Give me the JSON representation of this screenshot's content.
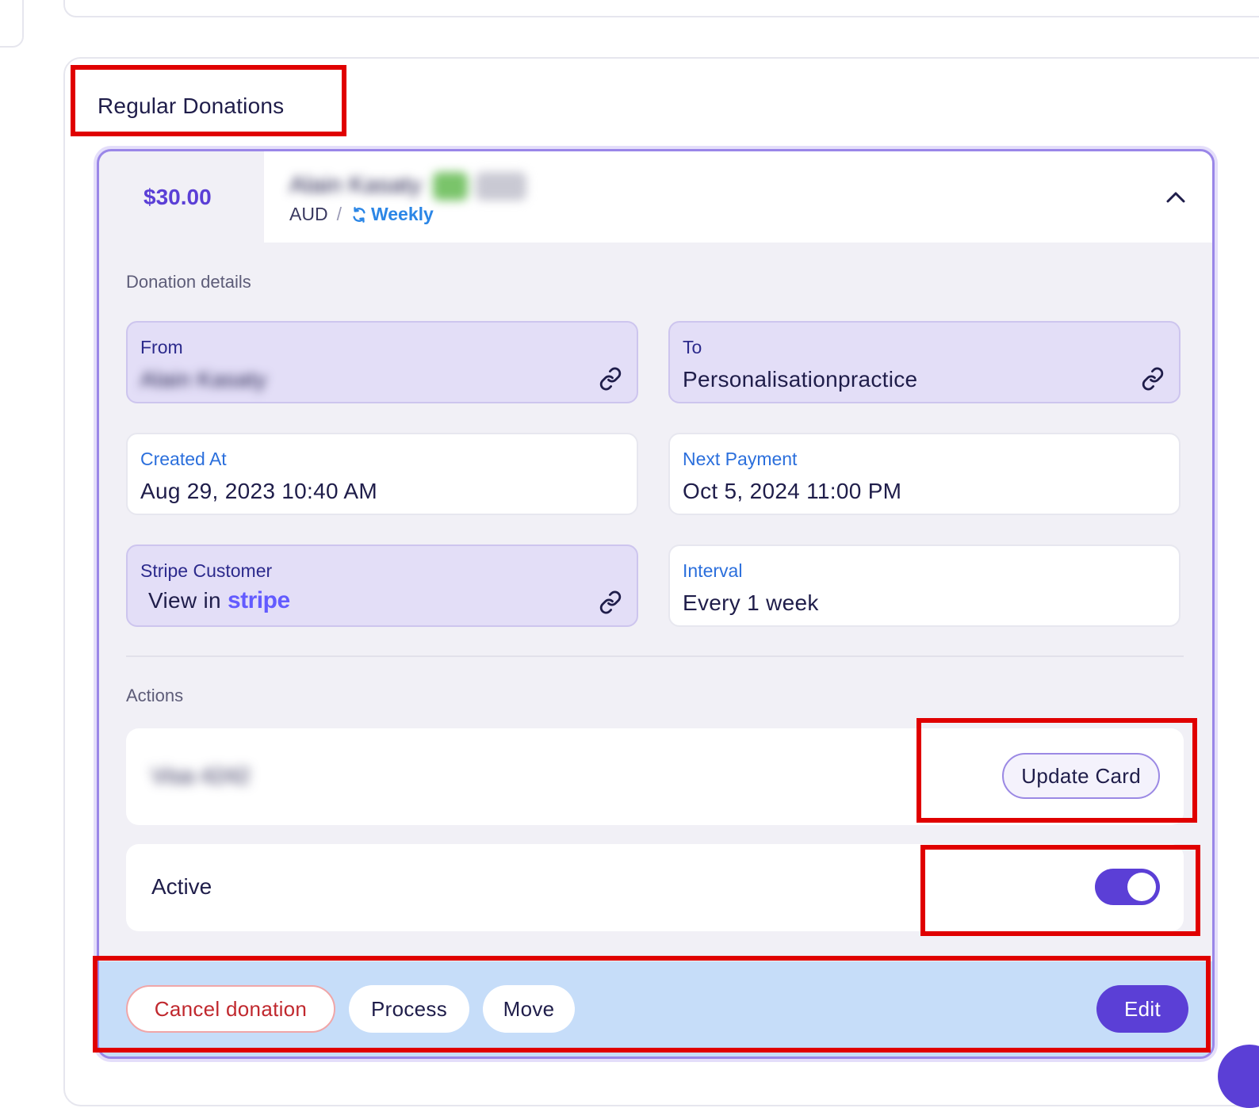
{
  "section": {
    "title": "Regular Donations"
  },
  "donation": {
    "amount": "$30.00",
    "donor_name_blurred": "Alain Kasaty",
    "currency": "AUD",
    "separator": "/",
    "frequency": "Weekly",
    "details_heading": "Donation details",
    "fields": {
      "from": {
        "label": "From",
        "value": "Alain Kasaty"
      },
      "to": {
        "label": "To",
        "value": "Personalisationpractice"
      },
      "created_at": {
        "label": "Created At",
        "value": "Aug 29, 2023 10:40 AM"
      },
      "next_payment": {
        "label": "Next Payment",
        "value": "Oct 5, 2024 11:00 PM"
      },
      "stripe_customer": {
        "label": "Stripe Customer",
        "value_prefix": "View in",
        "value_brand": "stripe"
      },
      "interval": {
        "label": "Interval",
        "value": "Every 1 week"
      }
    },
    "actions_heading": "Actions",
    "card": {
      "masked_blurred": "Visa 4242",
      "update_label": "Update Card"
    },
    "status": {
      "label": "Active",
      "enabled": true
    },
    "footer": {
      "cancel_label": "Cancel donation",
      "process_label": "Process",
      "move_label": "Move",
      "edit_label": "Edit"
    }
  },
  "icons": {
    "collapse": "chevron-up-icon",
    "frequency": "refresh-icon",
    "link": "link-icon"
  },
  "colors": {
    "accent": "#5b3fd6",
    "frequency": "#2b86e6",
    "linked_tile_bg": "#e3def7",
    "footer_bar_bg": "#c6ddf9",
    "danger": "#c0282e",
    "annotation": "#e00000"
  }
}
